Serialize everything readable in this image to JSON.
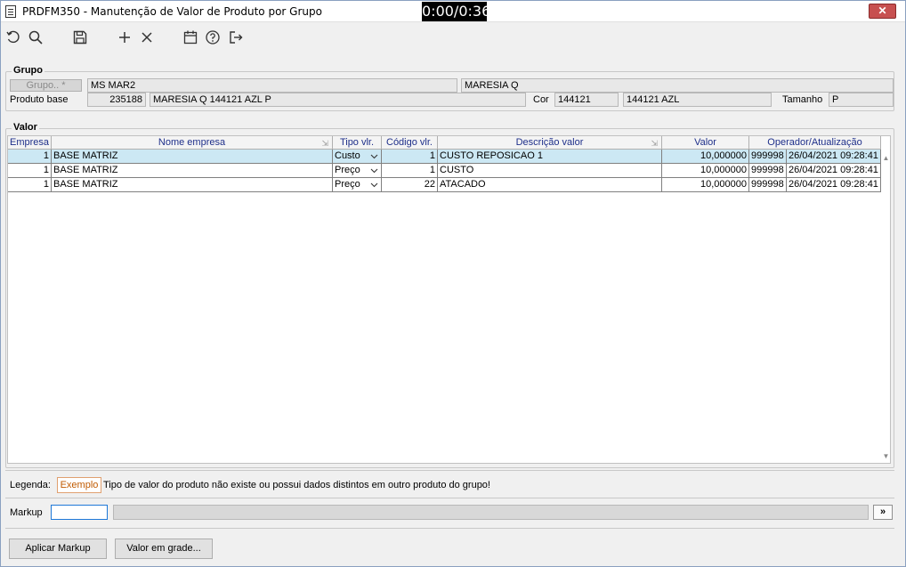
{
  "window": {
    "title": "PRDFM350 - Manutenção de Valor de Produto por Grupo",
    "timer": "0:00/0:36",
    "close_glyph": "✕"
  },
  "toolbar": {
    "icons": [
      "undo-icon",
      "search-icon",
      "save-icon",
      "add-icon",
      "delete-icon",
      "calendar-icon",
      "help-icon",
      "exit-icon"
    ]
  },
  "grupo": {
    "section_title": "Grupo",
    "grupo_button": "Grupo.. *",
    "grupo_code": "MS MAR2",
    "grupo_desc": "MARESIA Q",
    "produto_label": "Produto base",
    "produto_code": "235188",
    "produto_desc": "MARESIA Q 144121 AZL P",
    "cor_label": "Cor",
    "cor_code": "144121",
    "cor_desc": "144121 AZL",
    "tamanho_label": "Tamanho",
    "tamanho_value": "P"
  },
  "valor": {
    "section_title": "Valor",
    "headers": [
      "Empresa",
      "Nome empresa",
      "Tipo vlr.",
      "Código vlr.",
      "Descrição valor",
      "Valor",
      "Operador/Atualização"
    ],
    "rows": [
      {
        "empresa": "1",
        "nome": "BASE MATRIZ",
        "tipo": "Custo",
        "codigo": "1",
        "descricao": "CUSTO REPOSICAO 1",
        "valor": "10,000000",
        "operador": "999998",
        "atualizacao": "26/04/2021 09:28:41"
      },
      {
        "empresa": "1",
        "nome": "BASE MATRIZ",
        "tipo": "Preço",
        "codigo": "1",
        "descricao": "CUSTO",
        "valor": "10,000000",
        "operador": "999998",
        "atualizacao": "26/04/2021 09:28:41"
      },
      {
        "empresa": "1",
        "nome": "BASE MATRIZ",
        "tipo": "Preço",
        "codigo": "22",
        "descricao": "ATACADO",
        "valor": "10,000000",
        "operador": "999998",
        "atualizacao": "26/04/2021 09:28:41"
      }
    ]
  },
  "legend": {
    "label": "Legenda:",
    "sample": "Exemplo",
    "text": "Tipo de valor do produto não existe ou possui dados distintos em outro produto do grupo!"
  },
  "markup": {
    "label": "Markup",
    "value": "",
    "go_label": "»"
  },
  "buttons": {
    "apply_markup": "Aplicar Markup",
    "valor_grade": "Valor em grade..."
  }
}
